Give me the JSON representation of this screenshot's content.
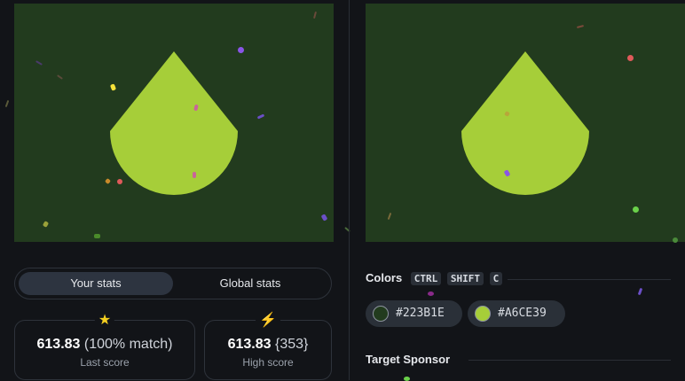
{
  "target_canvas": {
    "background": "#223B1E",
    "shape_color": "#A6CE39",
    "shape_icon": "droplet-shape"
  },
  "output_canvas": {
    "background": "#223B1E",
    "shape_color": "#A6CE39",
    "shape_icon": "droplet-shape"
  },
  "stats_tabs": {
    "active": "Your stats",
    "inactive": "Global stats"
  },
  "last_score": {
    "icon": "star-icon",
    "value": "613.83",
    "detail": "(100% match)",
    "label": "Last score"
  },
  "high_score": {
    "icon": "lightning-icon",
    "value": "613.83",
    "detail": "{353}",
    "label": "High score"
  },
  "colors_section": {
    "title": "Colors",
    "shortcut_keys": [
      "CTRL",
      "SHIFT",
      "C"
    ],
    "swatches": [
      {
        "hex": "#223B1E",
        "label": "#223B1E"
      },
      {
        "hex": "#A6CE39",
        "label": "#A6CE39"
      }
    ]
  },
  "sponsor_section": {
    "title": "Target Sponsor"
  }
}
